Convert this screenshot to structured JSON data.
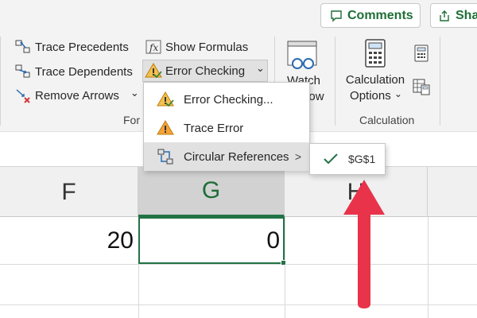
{
  "header": {
    "comments_label": "Comments",
    "share_label": "Sha"
  },
  "ribbon": {
    "formula_auditing": {
      "trace_precedents": "Trace Precedents",
      "trace_dependents": "Trace Dependents",
      "remove_arrows": "Remove Arrows",
      "remove_arrows_caret": "⌄",
      "show_formulas": "Show Formulas",
      "error_checking": "Error Checking",
      "error_checking_caret": "⌄",
      "group_label_partial": "For"
    },
    "watch_window": {
      "label_line1": "Watch",
      "label_line2_partial": "ow"
    },
    "calculation": {
      "options_line1": "Calculation",
      "options_line2": "Options",
      "options_caret": "⌄",
      "group_label": "Calculation"
    }
  },
  "error_menu": {
    "items": [
      {
        "label": "Error Checking...",
        "icon": "warning-check-icon"
      },
      {
        "label": "Trace Error",
        "icon": "warning-icon"
      },
      {
        "label": "Circular References",
        "icon": "circular-reference-icon",
        "submenu_arrow": ">"
      }
    ],
    "hovered_index": 2
  },
  "circular_submenu": {
    "items": [
      {
        "label": "$G$1",
        "checked": true
      }
    ]
  },
  "sheet": {
    "columns": [
      "F",
      "G",
      "H"
    ],
    "selected_column": "G",
    "cells": {
      "F1": "20",
      "G1": "0"
    }
  },
  "colors": {
    "accent_green": "#217346",
    "annotation_red": "#e8334a",
    "warning_orange": "#e8a317"
  }
}
